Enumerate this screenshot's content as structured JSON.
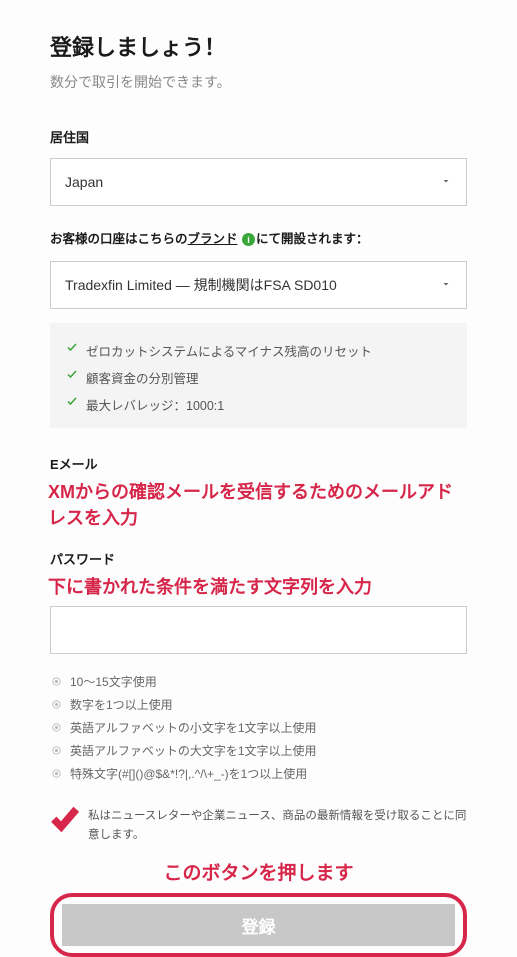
{
  "header": {
    "title": "登録しましょう！",
    "subtitle": "数分で取引を開始できます。"
  },
  "country": {
    "label": "居住国",
    "value": "Japan"
  },
  "brand": {
    "label_pre": "お客様の口座はこちらの",
    "label_link": "ブランド",
    "label_post": "にて開設されます：",
    "value": "Tradexfin Limited — 規制機関はFSA SD010"
  },
  "features": [
    "ゼロカットシステムによるマイナス残高のリセット",
    "顧客資金の分別管理",
    "最大レバレッジ：1000:1"
  ],
  "email": {
    "label": "Eメール",
    "annotation": "XMからの確認メールを受信するためのメールアドレスを入力"
  },
  "password": {
    "label": "パスワード",
    "annotation": "下に書かれた条件を満たす文字列を入力",
    "rules": [
      "10～15文字使用",
      "数字を1つ以上使用",
      "英語アルファベットの小文字を1文字以上使用",
      "英語アルファベットの大文字を1文字以上使用",
      "特殊文字(#[]()@$&*!?|,.^/\\+_-)を1つ以上使用"
    ]
  },
  "consent": {
    "text": "私はニュースレターや企業ニュース、商品の最新情報を受け取ることに同意します。"
  },
  "cta": {
    "annotation": "このボタンを押します",
    "label": "登録"
  }
}
